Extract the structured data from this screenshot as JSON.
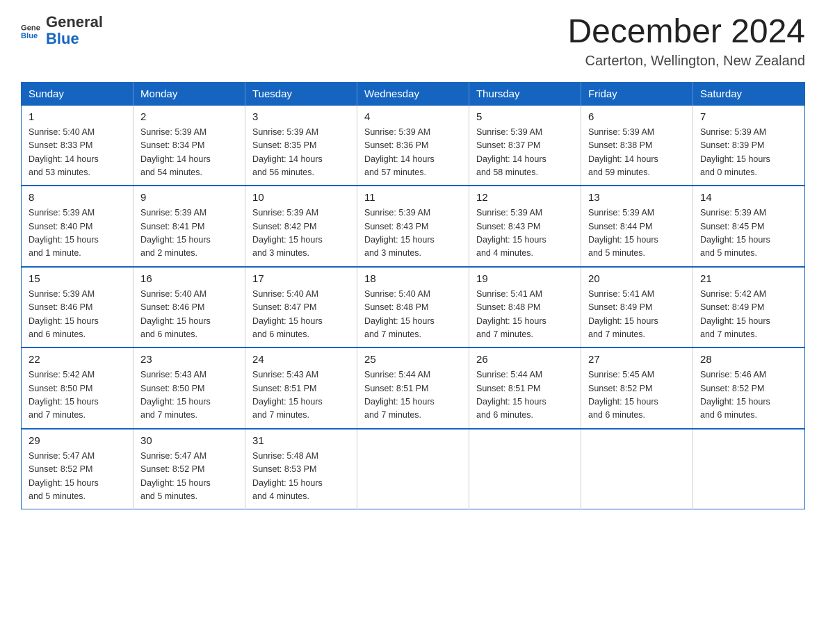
{
  "logo": {
    "text_general": "General",
    "text_blue": "Blue",
    "icon_alt": "GeneralBlue logo"
  },
  "title": "December 2024",
  "location": "Carterton, Wellington, New Zealand",
  "weekdays": [
    "Sunday",
    "Monday",
    "Tuesday",
    "Wednesday",
    "Thursday",
    "Friday",
    "Saturday"
  ],
  "weeks": [
    [
      {
        "day": "1",
        "sunrise": "5:40 AM",
        "sunset": "8:33 PM",
        "daylight": "14 hours and 53 minutes."
      },
      {
        "day": "2",
        "sunrise": "5:39 AM",
        "sunset": "8:34 PM",
        "daylight": "14 hours and 54 minutes."
      },
      {
        "day": "3",
        "sunrise": "5:39 AM",
        "sunset": "8:35 PM",
        "daylight": "14 hours and 56 minutes."
      },
      {
        "day": "4",
        "sunrise": "5:39 AM",
        "sunset": "8:36 PM",
        "daylight": "14 hours and 57 minutes."
      },
      {
        "day": "5",
        "sunrise": "5:39 AM",
        "sunset": "8:37 PM",
        "daylight": "14 hours and 58 minutes."
      },
      {
        "day": "6",
        "sunrise": "5:39 AM",
        "sunset": "8:38 PM",
        "daylight": "14 hours and 59 minutes."
      },
      {
        "day": "7",
        "sunrise": "5:39 AM",
        "sunset": "8:39 PM",
        "daylight": "15 hours and 0 minutes."
      }
    ],
    [
      {
        "day": "8",
        "sunrise": "5:39 AM",
        "sunset": "8:40 PM",
        "daylight": "15 hours and 1 minute."
      },
      {
        "day": "9",
        "sunrise": "5:39 AM",
        "sunset": "8:41 PM",
        "daylight": "15 hours and 2 minutes."
      },
      {
        "day": "10",
        "sunrise": "5:39 AM",
        "sunset": "8:42 PM",
        "daylight": "15 hours and 3 minutes."
      },
      {
        "day": "11",
        "sunrise": "5:39 AM",
        "sunset": "8:43 PM",
        "daylight": "15 hours and 3 minutes."
      },
      {
        "day": "12",
        "sunrise": "5:39 AM",
        "sunset": "8:43 PM",
        "daylight": "15 hours and 4 minutes."
      },
      {
        "day": "13",
        "sunrise": "5:39 AM",
        "sunset": "8:44 PM",
        "daylight": "15 hours and 5 minutes."
      },
      {
        "day": "14",
        "sunrise": "5:39 AM",
        "sunset": "8:45 PM",
        "daylight": "15 hours and 5 minutes."
      }
    ],
    [
      {
        "day": "15",
        "sunrise": "5:39 AM",
        "sunset": "8:46 PM",
        "daylight": "15 hours and 6 minutes."
      },
      {
        "day": "16",
        "sunrise": "5:40 AM",
        "sunset": "8:46 PM",
        "daylight": "15 hours and 6 minutes."
      },
      {
        "day": "17",
        "sunrise": "5:40 AM",
        "sunset": "8:47 PM",
        "daylight": "15 hours and 6 minutes."
      },
      {
        "day": "18",
        "sunrise": "5:40 AM",
        "sunset": "8:48 PM",
        "daylight": "15 hours and 7 minutes."
      },
      {
        "day": "19",
        "sunrise": "5:41 AM",
        "sunset": "8:48 PM",
        "daylight": "15 hours and 7 minutes."
      },
      {
        "day": "20",
        "sunrise": "5:41 AM",
        "sunset": "8:49 PM",
        "daylight": "15 hours and 7 minutes."
      },
      {
        "day": "21",
        "sunrise": "5:42 AM",
        "sunset": "8:49 PM",
        "daylight": "15 hours and 7 minutes."
      }
    ],
    [
      {
        "day": "22",
        "sunrise": "5:42 AM",
        "sunset": "8:50 PM",
        "daylight": "15 hours and 7 minutes."
      },
      {
        "day": "23",
        "sunrise": "5:43 AM",
        "sunset": "8:50 PM",
        "daylight": "15 hours and 7 minutes."
      },
      {
        "day": "24",
        "sunrise": "5:43 AM",
        "sunset": "8:51 PM",
        "daylight": "15 hours and 7 minutes."
      },
      {
        "day": "25",
        "sunrise": "5:44 AM",
        "sunset": "8:51 PM",
        "daylight": "15 hours and 7 minutes."
      },
      {
        "day": "26",
        "sunrise": "5:44 AM",
        "sunset": "8:51 PM",
        "daylight": "15 hours and 6 minutes."
      },
      {
        "day": "27",
        "sunrise": "5:45 AM",
        "sunset": "8:52 PM",
        "daylight": "15 hours and 6 minutes."
      },
      {
        "day": "28",
        "sunrise": "5:46 AM",
        "sunset": "8:52 PM",
        "daylight": "15 hours and 6 minutes."
      }
    ],
    [
      {
        "day": "29",
        "sunrise": "5:47 AM",
        "sunset": "8:52 PM",
        "daylight": "15 hours and 5 minutes."
      },
      {
        "day": "30",
        "sunrise": "5:47 AM",
        "sunset": "8:52 PM",
        "daylight": "15 hours and 5 minutes."
      },
      {
        "day": "31",
        "sunrise": "5:48 AM",
        "sunset": "8:53 PM",
        "daylight": "15 hours and 4 minutes."
      },
      null,
      null,
      null,
      null
    ]
  ]
}
